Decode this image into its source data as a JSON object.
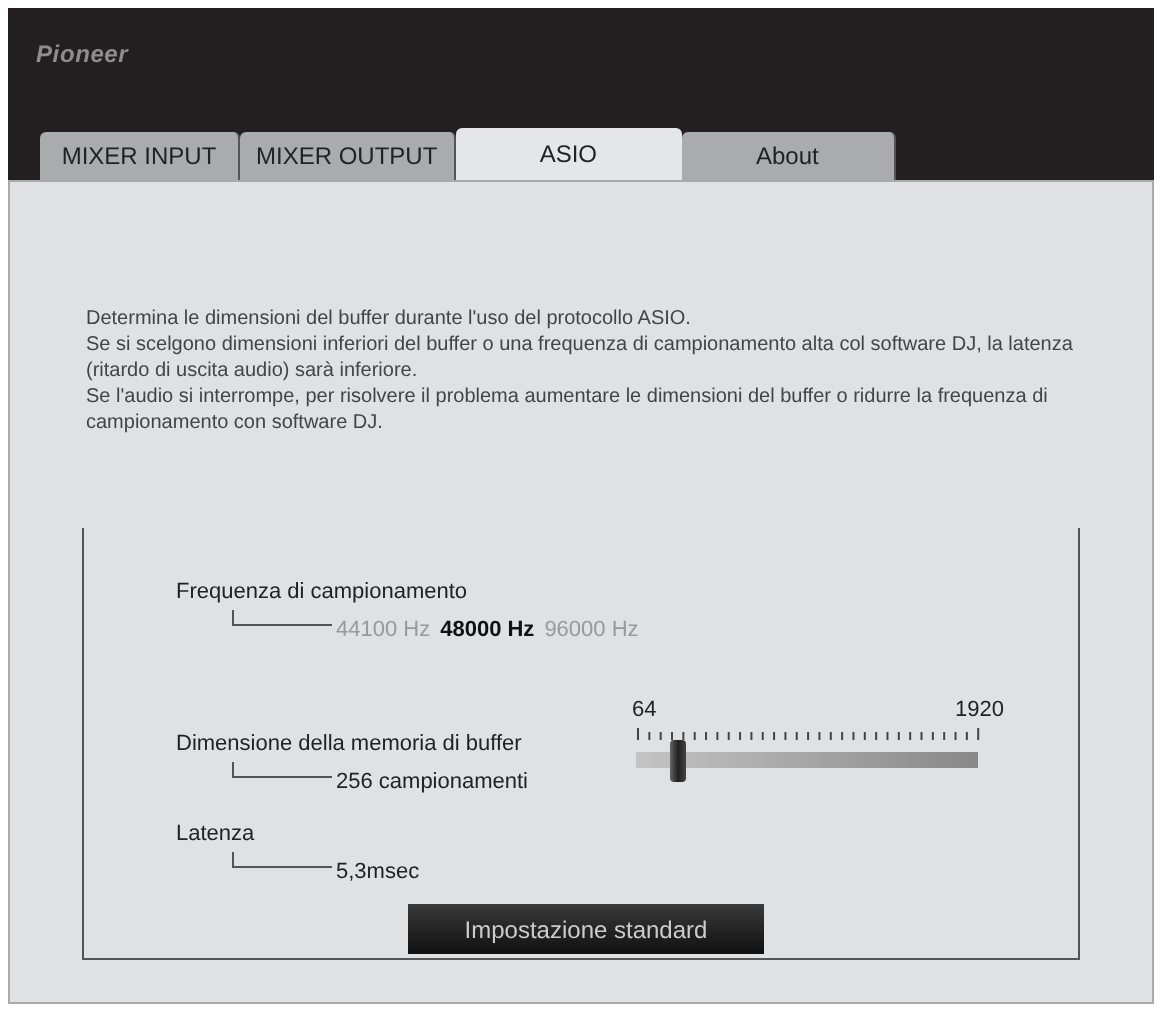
{
  "logo": "Pioneer",
  "tabs": [
    {
      "label": "MIXER INPUT",
      "selected": false
    },
    {
      "label": "MIXER OUTPUT",
      "selected": false
    },
    {
      "label": "ASIO",
      "selected": true
    },
    {
      "label": "About",
      "selected": false
    }
  ],
  "description": [
    "Determina le dimensioni del buffer durante l'uso del protocollo ASIO.",
    "Se si scelgono dimensioni inferiori del buffer o una frequenza di campionamento alta col software DJ, la latenza (ritardo di uscita audio) sarà inferiore.",
    "Se l'audio si interrompe, per risolvere il problema aumentare le dimensioni del buffer o ridurre la frequenza di campionamento con software DJ."
  ],
  "sample_rate": {
    "label": "Frequenza di campionamento",
    "options": [
      {
        "label": "44100 Hz",
        "selected": false
      },
      {
        "label": "48000 Hz",
        "selected": true
      },
      {
        "label": "96000 Hz",
        "selected": false
      }
    ]
  },
  "buffer": {
    "label": "Dimensione della memoria di buffer",
    "value": "256 campionamenti",
    "min_label": "64",
    "max_label": "1920",
    "level": 0.1
  },
  "latency": {
    "label": "Latenza",
    "value": "5,3msec"
  },
  "default_button": "Impostazione standard"
}
